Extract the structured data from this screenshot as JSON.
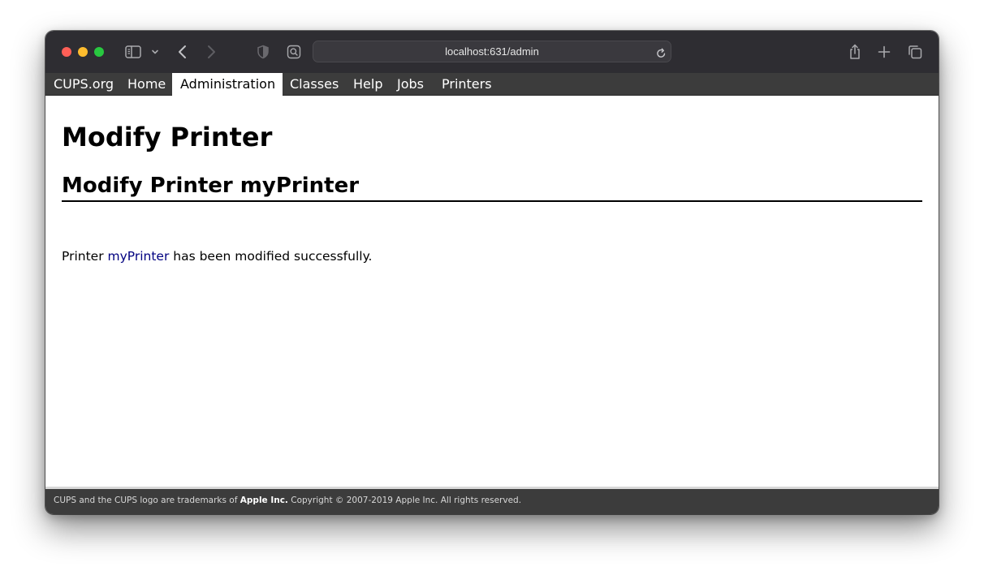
{
  "browser": {
    "url": "localhost:631/admin",
    "icons": [
      "close-dot",
      "minimize-dot",
      "maximize-dot",
      "sidebar-icon",
      "chevron-down-icon",
      "back-icon",
      "forward-icon",
      "privacy-shield-icon",
      "reader-icon",
      "reload-icon",
      "share-icon",
      "new-tab-icon",
      "tabs-overview-icon"
    ]
  },
  "nav": {
    "items": [
      {
        "label": "CUPS.org",
        "active": false
      },
      {
        "label": "Home",
        "active": false
      },
      {
        "label": "Administration",
        "active": true
      },
      {
        "label": "Classes",
        "active": false
      },
      {
        "label": "Help",
        "active": false
      },
      {
        "label": "Jobs",
        "active": false
      },
      {
        "label": "Printers",
        "active": false
      }
    ]
  },
  "main": {
    "title": "Modify Printer",
    "subtitle": "Modify Printer myPrinter",
    "message_prefix": "Printer ",
    "printer_link": "myPrinter",
    "message_suffix": " has been modified successfully."
  },
  "footer": {
    "text_prefix": "CUPS and the CUPS logo are trademarks of ",
    "company": "Apple Inc.",
    "text_suffix": " Copyright © 2007-2019 Apple Inc. All rights reserved."
  },
  "colors": {
    "toolbar": "#2e2d32",
    "navbar": "#3c3c3c",
    "link": "#000080",
    "close": "#ff5f57",
    "minimize": "#febc2e",
    "maximize": "#28c840"
  }
}
